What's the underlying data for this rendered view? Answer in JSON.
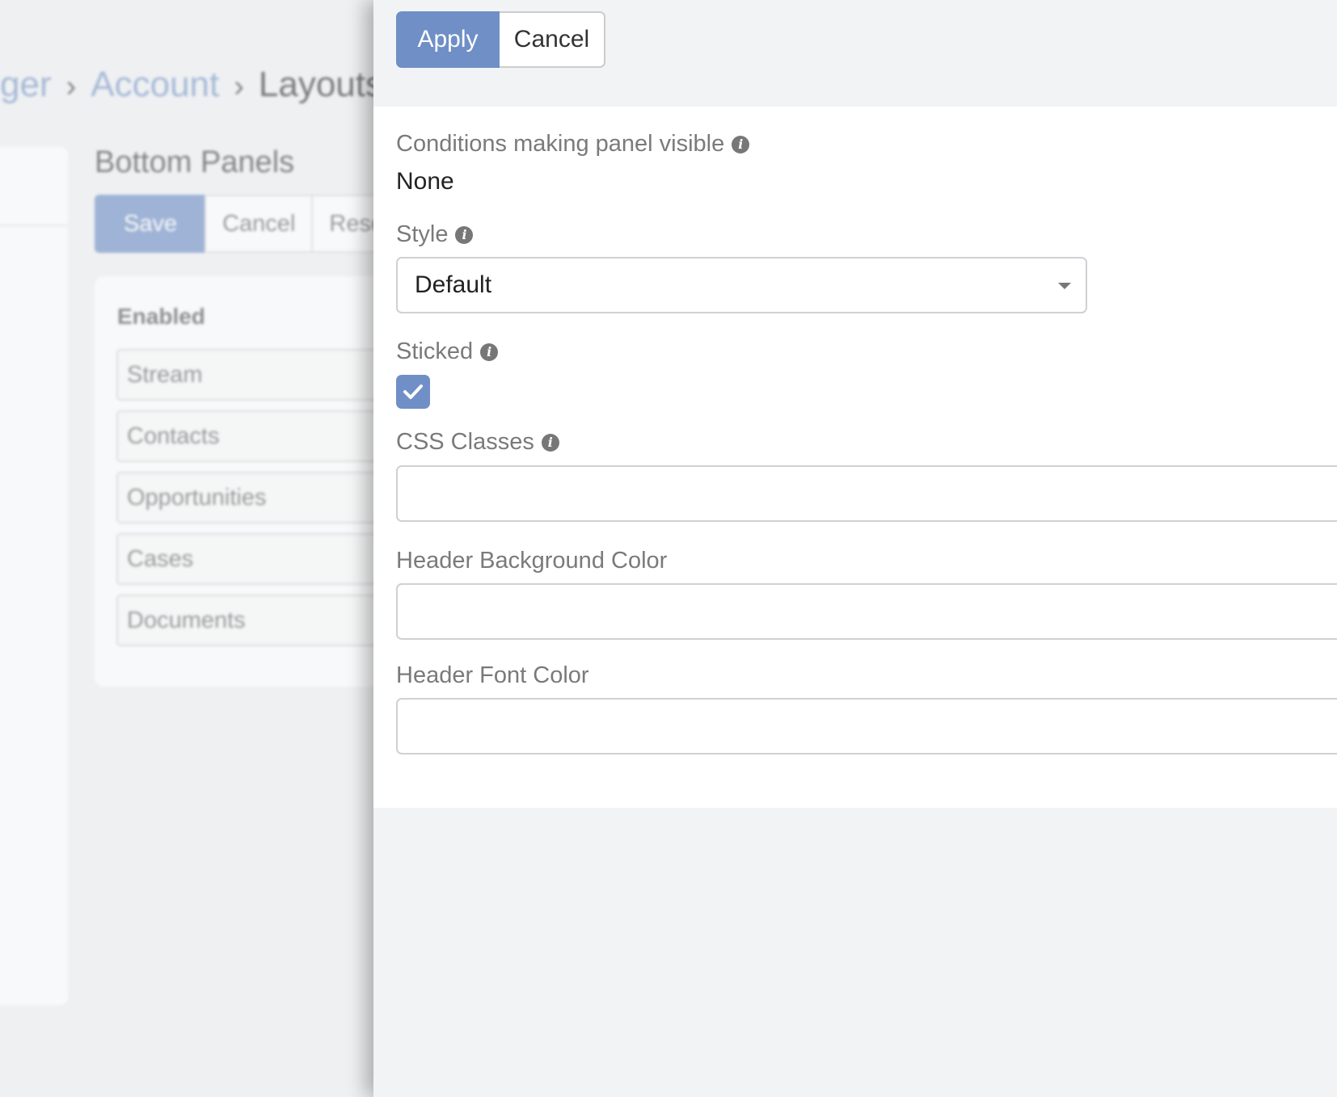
{
  "background": {
    "breadcrumb": {
      "items": [
        "ger",
        "Account",
        "Layouts"
      ],
      "separator": "›"
    },
    "bottom_panels": {
      "title": "Bottom Panels",
      "toolbar": {
        "save_label": "Save",
        "cancel_label": "Cancel",
        "reset_label": "Reset"
      },
      "enabled_title": "Enabled",
      "enabled_items": [
        "Stream",
        "Contacts",
        "Opportunities",
        "Cases",
        "Documents"
      ]
    }
  },
  "modal": {
    "apply_label": "Apply",
    "cancel_label": "Cancel",
    "fields": {
      "conditions": {
        "label": "Conditions making panel visible",
        "value": "None"
      },
      "style": {
        "label": "Style",
        "value": "Default"
      },
      "sticked": {
        "label": "Sticked",
        "checked": true
      },
      "css_classes": {
        "label": "CSS Classes",
        "value": ""
      },
      "header_bg_color": {
        "label": "Header Background Color",
        "value": ""
      },
      "header_font_color": {
        "label": "Header Font Color",
        "value": ""
      }
    }
  },
  "colors": {
    "accent": "#6f8fc6",
    "panel_bg": "#f2f3f5",
    "label": "#7a7a7a"
  }
}
